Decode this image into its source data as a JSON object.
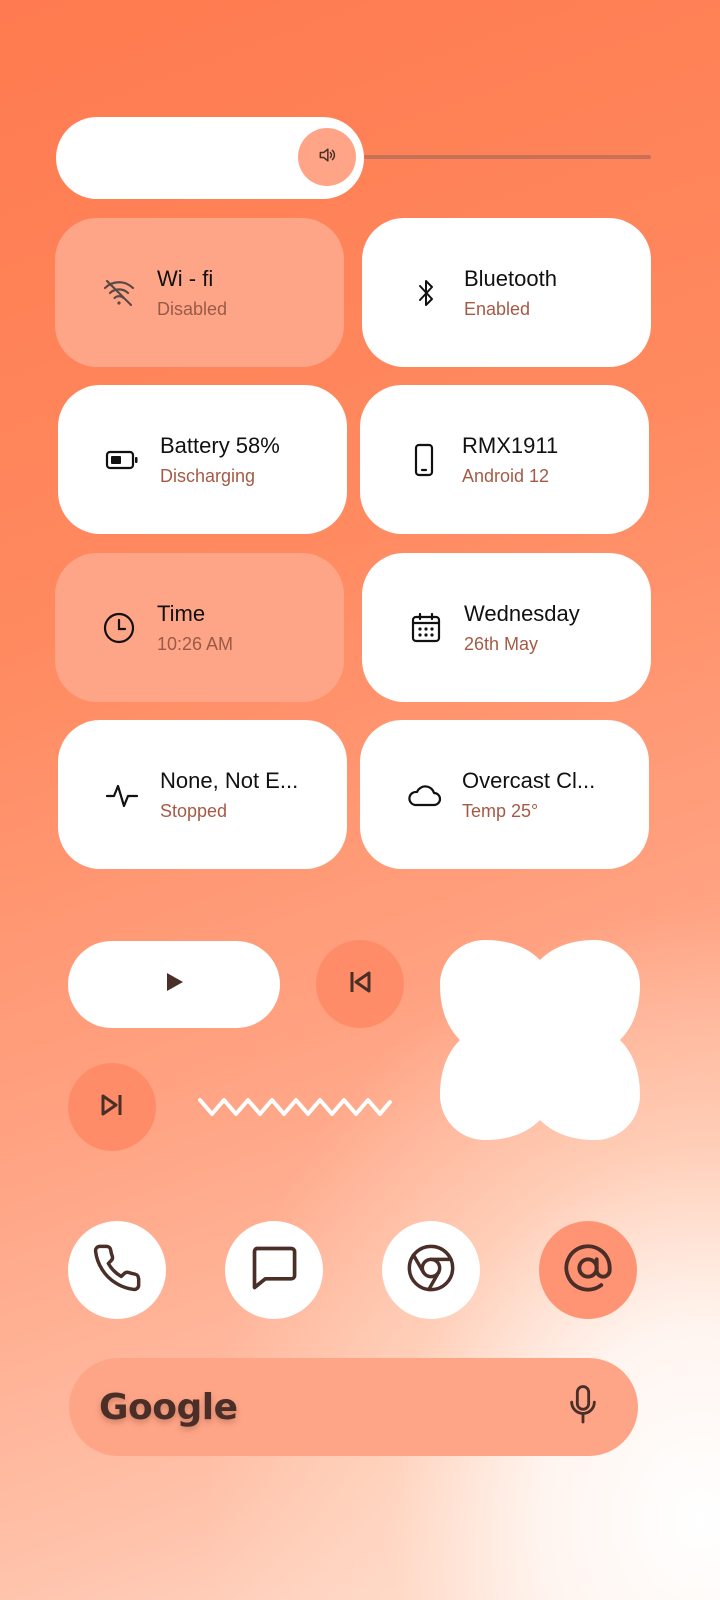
{
  "colors": {
    "accent": "#ff8c68",
    "accent_soft": "#ffa587",
    "subtitle": "#a65a45",
    "icon_dark": "#4a2f28"
  },
  "volume": {
    "icon": "speaker-icon",
    "level": 0.47
  },
  "tiles": [
    {
      "title": "Wi - fi",
      "subtitle": "Disabled",
      "icon": "wifi-off-icon",
      "active": false
    },
    {
      "title": "Bluetooth",
      "subtitle": "Enabled",
      "icon": "bluetooth-icon",
      "active": true
    },
    {
      "title": "Battery 58%",
      "subtitle": "Discharging",
      "icon": "battery-icon",
      "active": true
    },
    {
      "title": "RMX1911",
      "subtitle": "Android 12",
      "icon": "phone-icon",
      "active": true
    },
    {
      "title": "Time",
      "subtitle": "10:26 AM",
      "icon": "clock-icon",
      "active": false
    },
    {
      "title": "Wednesday",
      "subtitle": "26th May",
      "icon": "calendar-icon",
      "active": true
    },
    {
      "title": "None, Not E...",
      "subtitle": "Stopped",
      "icon": "activity-icon",
      "active": true
    },
    {
      "title": "Overcast Cl...",
      "subtitle": "Temp 25°",
      "icon": "cloud-icon",
      "active": true
    }
  ],
  "media": {
    "play_icon": "play-icon",
    "previous_icon": "skip-previous-icon",
    "next_icon": "skip-next-icon"
  },
  "dock": [
    {
      "name": "phone",
      "icon": "phone-call-icon"
    },
    {
      "name": "messages",
      "icon": "message-icon"
    },
    {
      "name": "chrome",
      "icon": "chrome-icon"
    },
    {
      "name": "email",
      "icon": "at-sign-icon"
    }
  ],
  "search": {
    "label": "Google",
    "mic_icon": "microphone-icon"
  }
}
